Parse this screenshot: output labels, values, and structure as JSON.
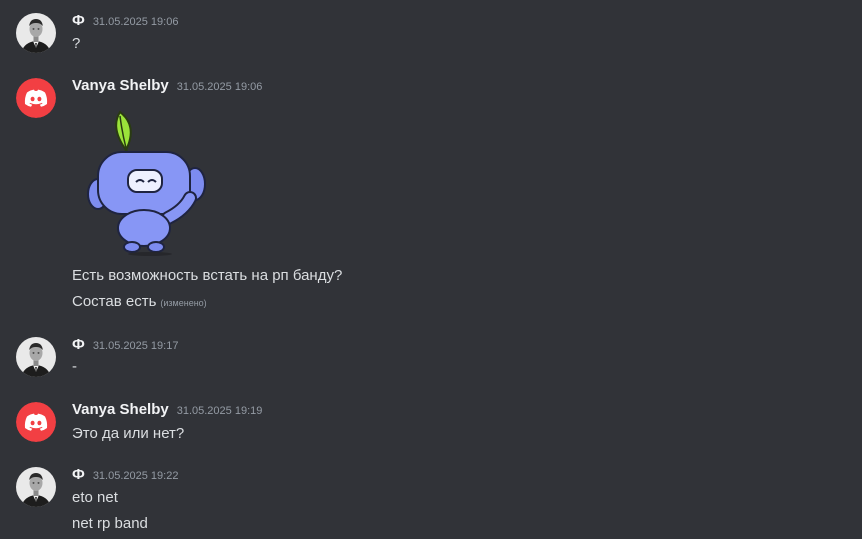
{
  "colors": {
    "background": "#313338",
    "text": "#dbdee1",
    "username": "#f2f3f5",
    "timestamp": "#949ba4",
    "discord_avatar": "#f23f43"
  },
  "messages": [
    {
      "author": "Ф",
      "avatar_icon": "person-photo-avatar",
      "timestamp": "31.05.2025 19:06",
      "lines": [
        "?"
      ]
    },
    {
      "author": "Vanya Shelby",
      "avatar_icon": "discord-logo-avatar",
      "timestamp": "31.05.2025 19:06",
      "sticker_icon": "wumpus-sprout-sticker",
      "lines": [
        "Есть возможность встать на рп банду?",
        "Состав есть"
      ],
      "edited_label": "(изменено)"
    },
    {
      "author": "Ф",
      "avatar_icon": "person-photo-avatar",
      "timestamp": "31.05.2025 19:17",
      "lines": [
        "-"
      ]
    },
    {
      "author": "Vanya Shelby",
      "avatar_icon": "discord-logo-avatar",
      "timestamp": "31.05.2025 19:19",
      "lines": [
        "Это да или нет?"
      ]
    },
    {
      "author": "Ф",
      "avatar_icon": "person-photo-avatar",
      "timestamp": "31.05.2025 19:22",
      "lines": [
        "eto net",
        "net rp band"
      ]
    }
  ]
}
